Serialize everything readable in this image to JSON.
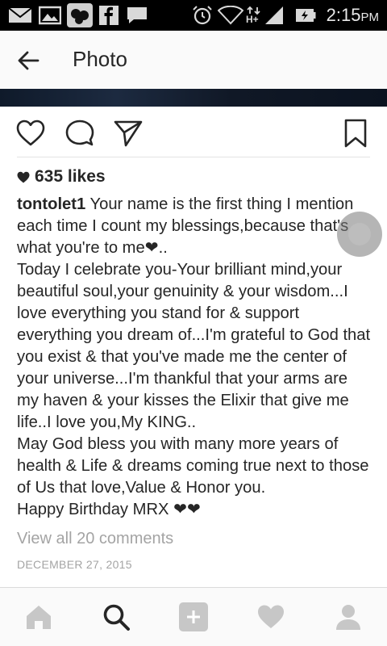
{
  "status_bar": {
    "time": "2:15",
    "ampm": "PM",
    "icons": [
      "mail-icon",
      "gallery-icon",
      "app-icon",
      "facebook-icon",
      "chat-icon",
      "alarm-icon",
      "wifi-icon",
      "data-icon",
      "signal-icon",
      "battery-icon"
    ]
  },
  "header": {
    "title": "Photo",
    "back_icon": "back-arrow-icon"
  },
  "actions": [
    "like-icon",
    "comment-icon",
    "share-icon",
    "bookmark-icon"
  ],
  "post": {
    "likes": "635 likes",
    "username": "tontolet1",
    "caption_lines": [
      " Your name is the first thing I mention each time I count my blessings,because that's what you're to me❤..",
      "Today I celebrate you-Your brilliant mind,your beautiful soul,your genuinity & your wisdom...I love everything you stand for & support everything you dream of...I'm grateful to God that you exist & that you've made me the center of your universe...I'm thankful that your arms are my haven & your kisses the Elixir that give me life..I love you,My KING..",
      "May God bless you with many more years of health & Life & dreams coming true next to those of Us that love,Value & Honor you.",
      "Happy Birthday MRX ❤❤"
    ],
    "view_comments": "View all 20 comments",
    "date": "DECEMBER 27, 2015"
  },
  "bottom_nav": [
    "home-icon",
    "search-icon",
    "add-icon",
    "activity-icon",
    "profile-icon"
  ],
  "colors": {
    "text": "#262626",
    "muted": "#a4a4a4",
    "status_bar": "#000000",
    "nav_inactive": "#c7c7c7"
  }
}
